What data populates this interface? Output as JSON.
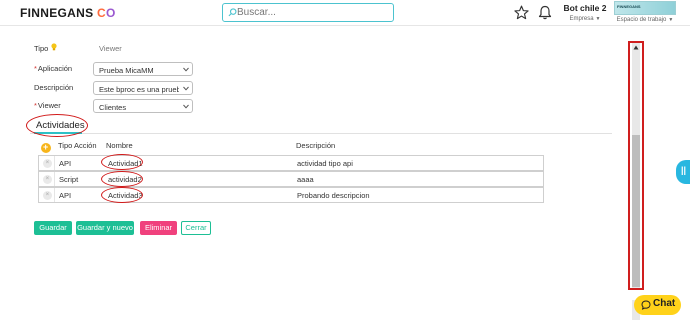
{
  "header": {
    "logo_main": "FINNEGANS",
    "logo_c": "C",
    "logo_o": "O",
    "search_placeholder": "Buscar...",
    "user_name": "Bot chile 2",
    "user_sub": "Empresa",
    "workspace_badge": "FINNEGANS",
    "workspace_sub": "Espacio de trabajo"
  },
  "form": {
    "tipo_label": "Tipo",
    "tipo_value": "Viewer",
    "aplicacion_label": "Aplicación",
    "aplicacion_value": "Prueba  MicaMM",
    "descripcion_label": "Descripción",
    "descripcion_value": "Este bproc es una prueba d",
    "viewer_label": "Viewer",
    "viewer_value": "Clientes"
  },
  "actividades": {
    "title": "Actividades",
    "columns": {
      "tipo": "Tipo Acción",
      "nombre": "Nombre",
      "descripcion": "Descripción"
    },
    "rows": [
      {
        "tipo": "API",
        "nombre": "Actividad1",
        "descripcion": "actividad tipo api"
      },
      {
        "tipo": "Script",
        "nombre": "actividad2",
        "descripcion": "aaaa"
      },
      {
        "tipo": "API",
        "nombre": "Actividad3",
        "descripcion": "Probando descripcion"
      }
    ]
  },
  "buttons": {
    "guardar": "Guardar",
    "guardar_nuevo": "Guardar y nuevo",
    "eliminar": "Eliminar",
    "cerrar": "Cerrar"
  },
  "side_tab": "||",
  "chat": {
    "label": "Chat"
  },
  "icons": [
    "search-icon",
    "star-icon",
    "bell-icon",
    "bulb-icon",
    "chevron-down-icon",
    "add-icon",
    "delete-icon",
    "chat-icon"
  ],
  "colors": {
    "accent": "#2ec1c6",
    "primary_button": "#1dbf95",
    "danger_button": "#f0417d",
    "chat": "#ffd21a",
    "annotation": "#d11a1a"
  }
}
